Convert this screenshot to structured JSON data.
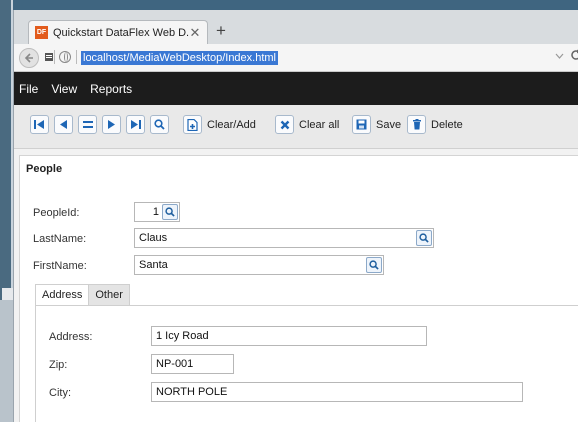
{
  "browser": {
    "tab_title": "Quickstart DataFlex Web D...",
    "favicon_text": "DF",
    "close_glyph": "✕",
    "newtab_glyph": "+",
    "url": "localhost/MediaWebDesktop/Index.html"
  },
  "menu": {
    "items": [
      "File",
      "View",
      "Reports"
    ]
  },
  "toolbar": {
    "clear_add_label": "Clear/Add",
    "clear_all_label": "Clear all",
    "save_label": "Save",
    "delete_label": "Delete"
  },
  "form": {
    "title": "People",
    "peopleid_label": "PeopleId:",
    "peopleid_value": "1",
    "lastname_label": "LastName:",
    "lastname_value": "Claus",
    "firstname_label": "FirstName:",
    "firstname_value": "Santa"
  },
  "tabs": {
    "address": "Address",
    "other": "Other"
  },
  "address": {
    "address_label": "Address:",
    "address_value": "1 Icy Road",
    "zip_label": "Zip:",
    "zip_value": "NP-001",
    "city_label": "City:",
    "city_value": "NORTH POLE"
  }
}
